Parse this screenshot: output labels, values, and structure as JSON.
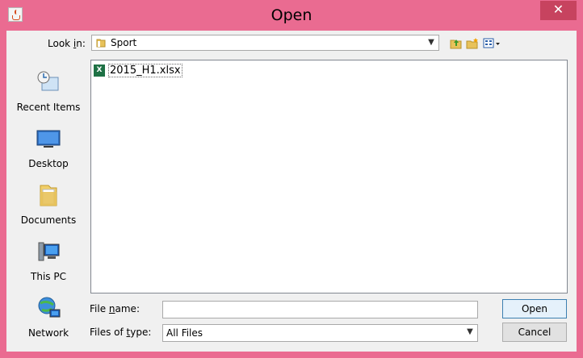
{
  "window": {
    "title": "Open",
    "close_glyph": "✕"
  },
  "lookin": {
    "label_pre": "Look ",
    "label_mnemonic": "i",
    "label_post": "n:",
    "value": "Sport"
  },
  "toolbar": {
    "icons": [
      "up-folder-icon",
      "new-folder-icon",
      "view-menu-icon"
    ]
  },
  "places": [
    {
      "label": "Recent Items",
      "icon": "recent-items-icon"
    },
    {
      "label": "Desktop",
      "icon": "desktop-icon"
    },
    {
      "label": "Documents",
      "icon": "documents-icon"
    },
    {
      "label": "This PC",
      "icon": "this-pc-icon"
    },
    {
      "label": "Network",
      "icon": "network-icon"
    }
  ],
  "files": [
    {
      "name": "2015_H1.xlsx",
      "type_badge": "X"
    }
  ],
  "filename": {
    "label_pre": "File ",
    "label_mnemonic": "n",
    "label_post": "ame:",
    "value": "",
    "placeholder": ""
  },
  "filetype": {
    "label_pre": "Files of ",
    "label_mnemonic": "t",
    "label_post": "ype:",
    "value": "All Files"
  },
  "buttons": {
    "open": "Open",
    "cancel": "Cancel"
  },
  "colors": {
    "title_bar": "#ea6b91",
    "close": "#c7435f",
    "excel": "#1e7145"
  }
}
